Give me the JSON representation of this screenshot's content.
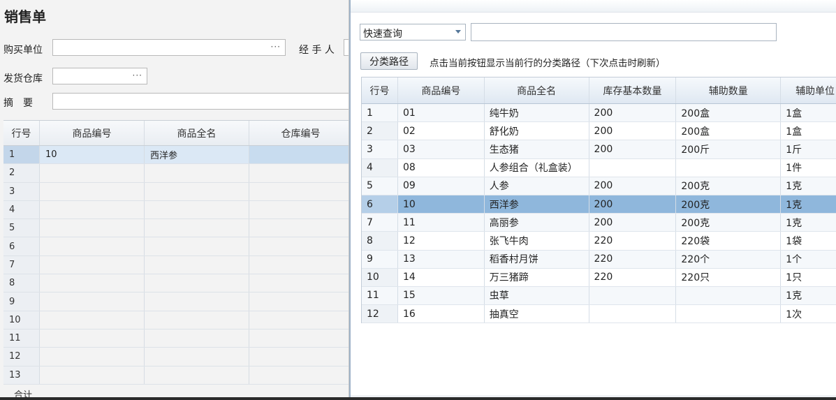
{
  "sales_form": {
    "title": "销售单",
    "buyer_label": "购买单位",
    "handler_label": "经 手 人",
    "warehouse_label": "发货仓库",
    "summary_label": "摘　要",
    "ellipsis": "···",
    "grid": {
      "columns": [
        "行号",
        "商品编号",
        "商品全名",
        "仓库编号"
      ],
      "rows": [
        {
          "no": "1",
          "code": "10",
          "name": "西洋参",
          "wh": ""
        },
        {
          "no": "2",
          "code": "",
          "name": "",
          "wh": ""
        },
        {
          "no": "3",
          "code": "",
          "name": "",
          "wh": ""
        },
        {
          "no": "4",
          "code": "",
          "name": "",
          "wh": ""
        },
        {
          "no": "5",
          "code": "",
          "name": "",
          "wh": ""
        },
        {
          "no": "6",
          "code": "",
          "name": "",
          "wh": ""
        },
        {
          "no": "7",
          "code": "",
          "name": "",
          "wh": ""
        },
        {
          "no": "8",
          "code": "",
          "name": "",
          "wh": ""
        },
        {
          "no": "9",
          "code": "",
          "name": "",
          "wh": ""
        },
        {
          "no": "10",
          "code": "",
          "name": "",
          "wh": ""
        },
        {
          "no": "11",
          "code": "",
          "name": "",
          "wh": ""
        },
        {
          "no": "12",
          "code": "",
          "name": "",
          "wh": ""
        },
        {
          "no": "13",
          "code": "",
          "name": "",
          "wh": ""
        }
      ],
      "total_label": "合计"
    }
  },
  "selector": {
    "quick_search": {
      "selected": "快速查询",
      "value": ""
    },
    "category_button": "分类路径",
    "category_hint": "点击当前按钮显示当前行的分类路径（下次点击时刷新）",
    "grid": {
      "columns": [
        "行号",
        "商品编号",
        "商品全名",
        "库存基本数量",
        "辅助数量",
        "辅助单位"
      ],
      "rows": [
        {
          "no": "1",
          "code": "01",
          "name": "纯牛奶",
          "qty": "200",
          "aux_qty": "200盒",
          "aux_unit": "1盒"
        },
        {
          "no": "2",
          "code": "02",
          "name": "舒化奶",
          "qty": "200",
          "aux_qty": "200盒",
          "aux_unit": "1盒"
        },
        {
          "no": "3",
          "code": "03",
          "name": "生态猪",
          "qty": "200",
          "aux_qty": "200斤",
          "aux_unit": "1斤"
        },
        {
          "no": "4",
          "code": "08",
          "name": "人参组合（礼盒装）",
          "qty": "",
          "aux_qty": "",
          "aux_unit": "1件"
        },
        {
          "no": "5",
          "code": "09",
          "name": "人参",
          "qty": "200",
          "aux_qty": "200克",
          "aux_unit": "1克"
        },
        {
          "no": "6",
          "code": "10",
          "name": "西洋参",
          "qty": "200",
          "aux_qty": "200克",
          "aux_unit": "1克"
        },
        {
          "no": "7",
          "code": "11",
          "name": "高丽参",
          "qty": "200",
          "aux_qty": "200克",
          "aux_unit": "1克"
        },
        {
          "no": "8",
          "code": "12",
          "name": "张飞牛肉",
          "qty": "220",
          "aux_qty": "220袋",
          "aux_unit": "1袋"
        },
        {
          "no": "9",
          "code": "13",
          "name": "稻香村月饼",
          "qty": "220",
          "aux_qty": "220个",
          "aux_unit": "1个"
        },
        {
          "no": "10",
          "code": "14",
          "name": "万三猪蹄",
          "qty": "220",
          "aux_qty": "220只",
          "aux_unit": "1只"
        },
        {
          "no": "11",
          "code": "15",
          "name": "虫草",
          "qty": "",
          "aux_qty": "",
          "aux_unit": "1克"
        },
        {
          "no": "12",
          "code": "16",
          "name": "抽真空",
          "qty": "",
          "aux_qty": "",
          "aux_unit": "1次"
        }
      ]
    }
  }
}
